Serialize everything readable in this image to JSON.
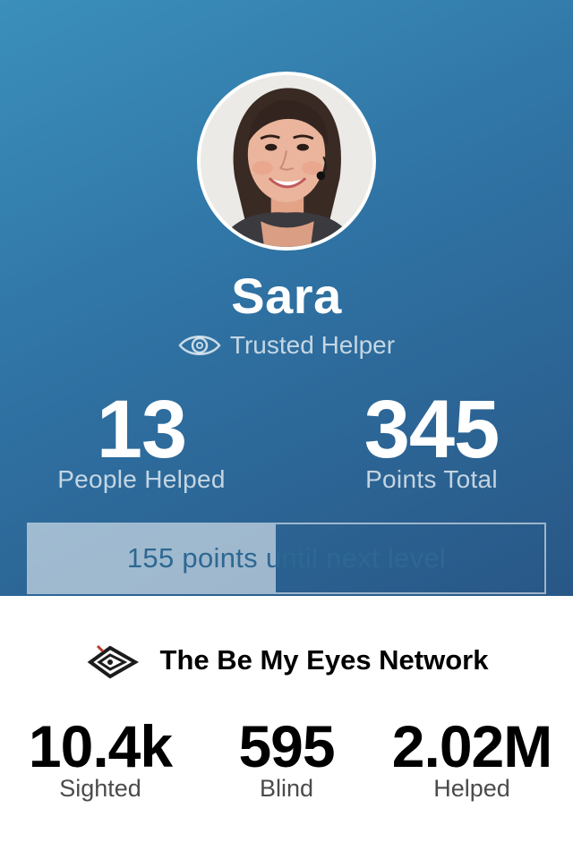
{
  "profile": {
    "name": "Sara",
    "role": "Trusted Helper",
    "role_icon": "eye-icon",
    "avatar": "profile-photo"
  },
  "stats": [
    {
      "value": "13",
      "label": "People Helped"
    },
    {
      "value": "345",
      "label": "Points Total"
    }
  ],
  "progress": {
    "text": "155 points until next level",
    "fraction": 0.48
  },
  "network": {
    "title": "The Be My Eyes Network",
    "logo_icon": "be-my-eyes-logo-icon",
    "items": [
      {
        "value": "10.4k",
        "label": "Sighted"
      },
      {
        "value": "595",
        "label": "Blind"
      },
      {
        "value": "2.02M",
        "label": "Helped"
      }
    ]
  },
  "colors": {
    "hero_top": "#3b8fbb",
    "hero_bottom": "#285786",
    "progress_text": "#2d6892"
  }
}
